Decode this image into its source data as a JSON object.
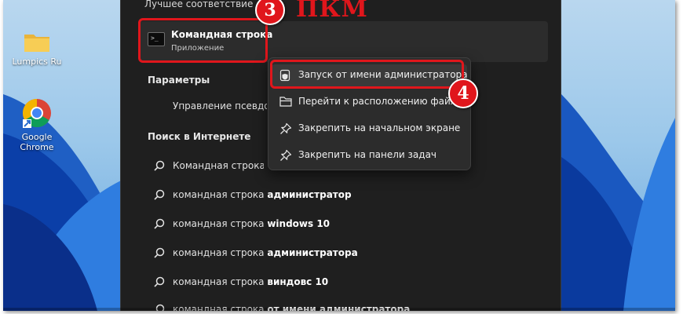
{
  "desktop": {
    "icons": [
      {
        "label": "Lumpics Ru",
        "icon": "folder-icon"
      },
      {
        "label": "Google Chrome",
        "icon": "chrome-icon"
      }
    ]
  },
  "panel": {
    "best_match": {
      "heading": "Лучшее соответствие",
      "title": "Командная строка",
      "subtitle": "Приложение",
      "icon": "terminal-icon"
    },
    "settings": {
      "heading": "Параметры",
      "item": "Управление псевдони"
    },
    "web": {
      "heading": "Поиск в Интернете",
      "items": [
        {
          "plain": "Командная строка - См",
          "bold": ""
        },
        {
          "plain": "командная строка ",
          "bold": "администратор"
        },
        {
          "plain": "командная строка ",
          "bold": "windows 10"
        },
        {
          "plain": "командная строка ",
          "bold": "администратора"
        },
        {
          "plain": "командная строка ",
          "bold": "виндовс 10"
        },
        {
          "plain": "командная строка ",
          "bold": "от имени администратора"
        }
      ]
    }
  },
  "context_menu": {
    "items": [
      {
        "label": "Запуск от имени администратора",
        "icon": "shield-icon",
        "highlighted": true
      },
      {
        "label": "Перейти к расположению файла",
        "icon": "folder-open-icon",
        "highlighted": false
      },
      {
        "label": "Закрепить на начальном экране",
        "icon": "pin-icon",
        "highlighted": false
      },
      {
        "label": "Закрепить на панели задач",
        "icon": "pin-icon",
        "highlighted": false
      }
    ]
  },
  "annotations": {
    "step3": "3",
    "step4": "4",
    "right_click_label": "ПКМ",
    "color": "#e0161c"
  }
}
